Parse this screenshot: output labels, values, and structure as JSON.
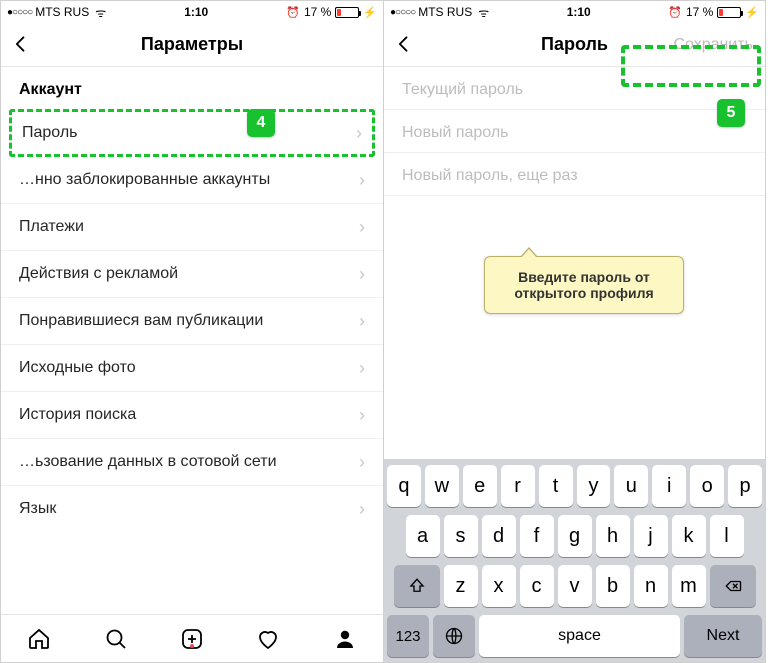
{
  "status": {
    "dots": "●○○○○",
    "carrier": "MTS RUS",
    "wifi": "ᯤ",
    "time": "1:10",
    "alarm": "⏰",
    "pct": "17 %",
    "charge": "⚡"
  },
  "left": {
    "title": "Параметры",
    "section": "Аккаунт",
    "items": [
      "Пароль",
      "…нно заблокированные аккаунты",
      "Платежи",
      "Действия с рекламой",
      "Понравившиеся вам публикации",
      "Исходные фото",
      "История поиска",
      "…ьзование данных в сотовой сети",
      "Язык"
    ],
    "badge": "4"
  },
  "right": {
    "title": "Пароль",
    "save": "Сохранить",
    "fields": [
      "Текущий пароль",
      "Новый пароль",
      "Новый пароль, еще раз"
    ],
    "callout": "Введите пароль от открытого профиля",
    "badge": "5"
  },
  "keyboard": {
    "r1": [
      "q",
      "w",
      "e",
      "r",
      "t",
      "y",
      "u",
      "i",
      "o",
      "p"
    ],
    "r2": [
      "a",
      "s",
      "d",
      "f",
      "g",
      "h",
      "j",
      "k",
      "l"
    ],
    "r3": [
      "z",
      "x",
      "c",
      "v",
      "b",
      "n",
      "m"
    ],
    "num": "123",
    "space": "space",
    "next": "Next"
  }
}
